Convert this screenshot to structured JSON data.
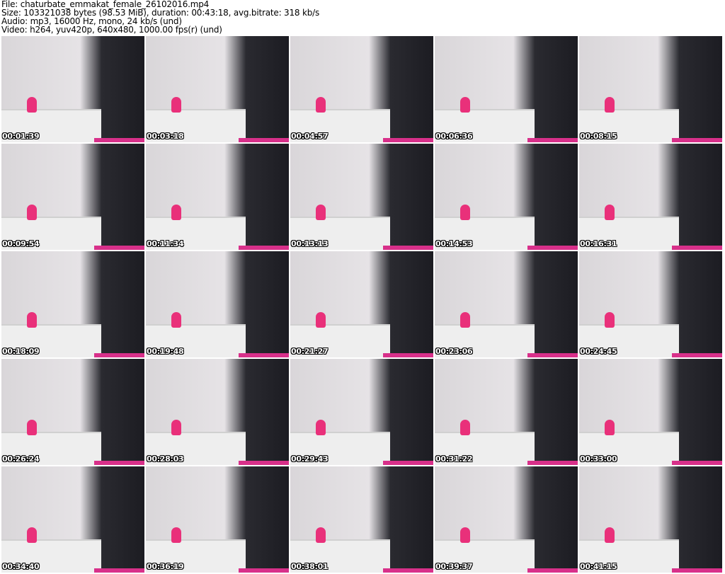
{
  "header": {
    "file": "File: chaturbate_emmakat_female_26102016.mp4",
    "size": "Size: 103321038 bytes (98.53 MiB), duration: 00:43:18, avg.bitrate: 318 kb/s",
    "audio": "Audio: mp3, 16000 Hz, mono, 24 kb/s (und)",
    "video": "Video: h264, yuv420p, 640x480, 1000.00 fps(r) (und)"
  },
  "thumbnails": [
    "00:01:39",
    "00:03:18",
    "00:04:57",
    "00:06:36",
    "00:08:15",
    "00:09:54",
    "00:11:34",
    "00:13:13",
    "00:14:53",
    "00:16:31",
    "00:18:09",
    "00:19:48",
    "00:21:27",
    "00:23:06",
    "00:24:45",
    "00:26:24",
    "00:28:03",
    "00:29:43",
    "00:31:22",
    "00:33:00",
    "00:34:40",
    "00:36:19",
    "00:38:01",
    "00:39:37",
    "00:41:15"
  ]
}
